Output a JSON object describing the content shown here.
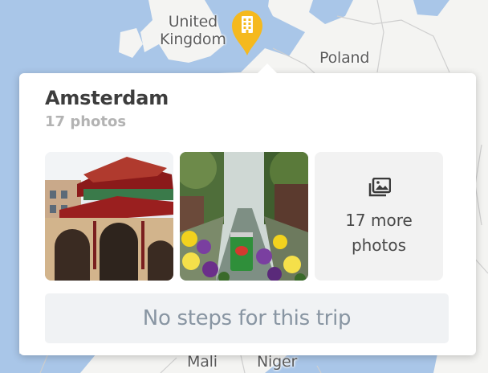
{
  "map": {
    "labels": {
      "united_kingdom": "United\nKingdom",
      "poland": "Poland",
      "mali": "Mali",
      "niger": "Niger"
    },
    "pin_icon": "hotel-building-icon",
    "colors": {
      "water": "#a9c6e8",
      "land": "#f4f4f2",
      "pin": "#f5b91e"
    }
  },
  "trip_card": {
    "city": "Amsterdam",
    "photo_count": "17 photos",
    "photos": [
      {
        "icon": "chinese-temple-photo"
      },
      {
        "icon": "canal-with-beer-can-photo"
      }
    ],
    "more_photos": {
      "icon": "image-gallery-icon",
      "label": "17 more\nphotos"
    },
    "no_steps_label": "No steps for this trip"
  }
}
